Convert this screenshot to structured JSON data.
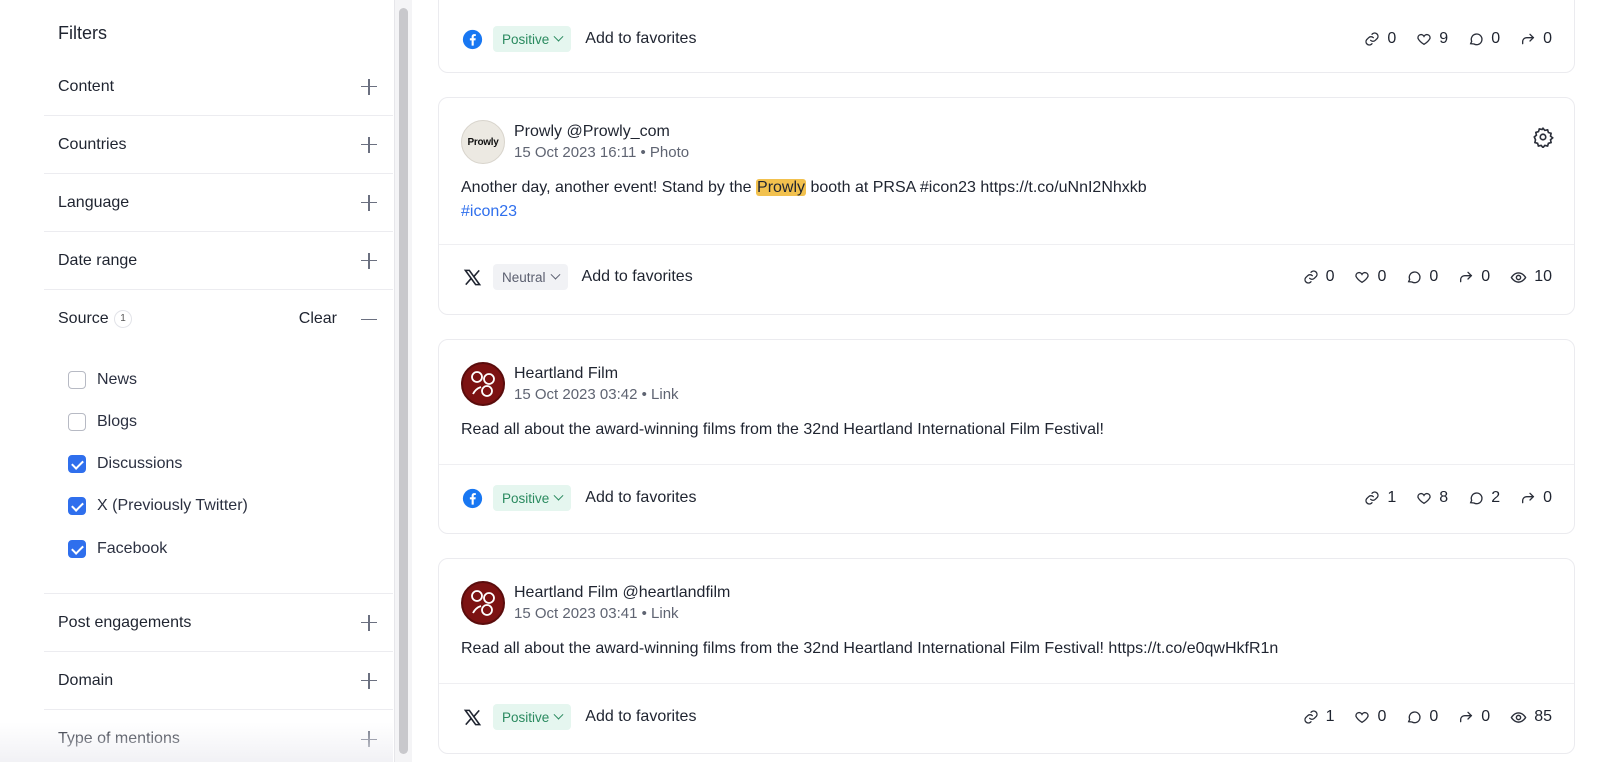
{
  "sidebar": {
    "title": "Filters",
    "sections_top": [
      {
        "label": "Content"
      },
      {
        "label": "Countries"
      },
      {
        "label": "Language"
      },
      {
        "label": "Date range"
      }
    ],
    "source": {
      "label": "Source",
      "count": "1",
      "clear_label": "Clear",
      "options": [
        {
          "label": "News",
          "checked": false
        },
        {
          "label": "Blogs",
          "checked": false
        },
        {
          "label": "Discussions",
          "checked": true
        },
        {
          "label": "X (Previously Twitter)",
          "checked": true
        },
        {
          "label": "Facebook",
          "checked": true
        }
      ]
    },
    "sections_bottom": [
      {
        "label": "Post engagements"
      },
      {
        "label": "Domain"
      },
      {
        "label": "Type of mentions"
      }
    ]
  },
  "feed": {
    "fav_label": "Add to favorites",
    "card0": {
      "network": "facebook",
      "sentiment": "Positive",
      "stats": {
        "links": "0",
        "likes": "9",
        "comments": "0",
        "shares": "0"
      }
    },
    "card1": {
      "author": "Prowly",
      "handle": "@Prowly_com",
      "avatar_text": "Prowly",
      "date": "15 Oct 2023 16:11",
      "type": "Photo",
      "text_before": "Another day, another event! Stand by the ",
      "text_highlight": "Prowly",
      "text_after": " booth at PRSA #icon23 https://t.co/uNnI2Nhxkb",
      "hashtag": "#icon23",
      "network": "x",
      "sentiment": "Neutral",
      "stats": {
        "links": "0",
        "likes": "0",
        "comments": "0",
        "shares": "0",
        "views": "10"
      }
    },
    "card2": {
      "author": "Heartland Film",
      "handle": "",
      "date": "15 Oct 2023 03:42",
      "type": "Link",
      "text": "Read all about the award-winning films from the 32nd Heartland International Film Festival!",
      "network": "facebook",
      "sentiment": "Positive",
      "stats": {
        "links": "1",
        "likes": "8",
        "comments": "2",
        "shares": "0"
      }
    },
    "card3": {
      "author": "Heartland Film",
      "handle": "@heartlandfilm",
      "date": "15 Oct 2023 03:41",
      "type": "Link",
      "text": "Read all about the award-winning films from the 32nd Heartland International Film Festival! https://t.co/e0qwHkfR1n",
      "network": "x",
      "sentiment": "Positive",
      "stats": {
        "links": "1",
        "likes": "0",
        "comments": "0",
        "shares": "0",
        "views": "85"
      }
    }
  },
  "colors": {
    "accent_blue": "#2f6fed",
    "facebook_blue": "#1877f2",
    "positive_bg": "#e5f6ef",
    "positive_text": "#2a8a5f",
    "highlight": "#f2c14e"
  }
}
